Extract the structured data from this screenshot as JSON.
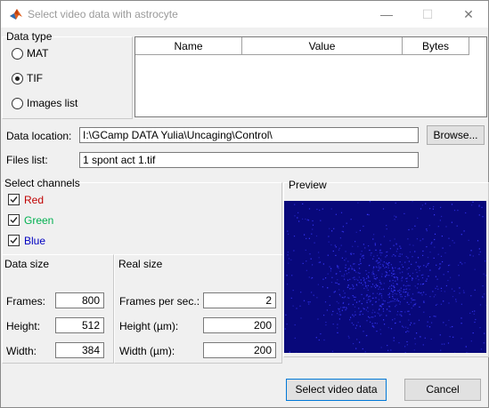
{
  "window": {
    "title": "Select video data with astrocyte"
  },
  "data_type": {
    "heading": "Data type",
    "options": [
      {
        "label": "MAT",
        "checked": false
      },
      {
        "label": "TIF",
        "checked": true
      },
      {
        "label": "Images list",
        "checked": false
      }
    ]
  },
  "variables_table": {
    "columns": [
      "Name",
      "Value",
      "Bytes"
    ],
    "rows": []
  },
  "data_location": {
    "label": "Data location:",
    "value": "I:\\GCamp DATA Yulia\\Uncaging\\Control\\",
    "browse_label": "Browse..."
  },
  "files_list": {
    "label": "Files list:",
    "value": "1 spont act 1.tif"
  },
  "channels": {
    "heading": "Select channels",
    "items": [
      {
        "label": "Red",
        "checked": true,
        "color": "#c00000"
      },
      {
        "label": "Green",
        "checked": true,
        "color": "#00b050"
      },
      {
        "label": "Blue",
        "checked": true,
        "color": "#0000c0"
      }
    ]
  },
  "preview": {
    "heading": "Preview",
    "background": "#08087a",
    "dots": "#3a3aff"
  },
  "data_size": {
    "heading": "Data size",
    "frames_label": "Frames:",
    "frames": "800",
    "height_label": "Height:",
    "height": "512",
    "width_label": "Width:",
    "width": "384"
  },
  "real_size": {
    "heading": "Real size",
    "fps_label": "Frames per sec.:",
    "fps": "2",
    "height_label": "Height (µm):",
    "height": "200",
    "width_label": "Width (µm):",
    "width": "200"
  },
  "buttons": {
    "select": "Select video data",
    "cancel": "Cancel"
  }
}
